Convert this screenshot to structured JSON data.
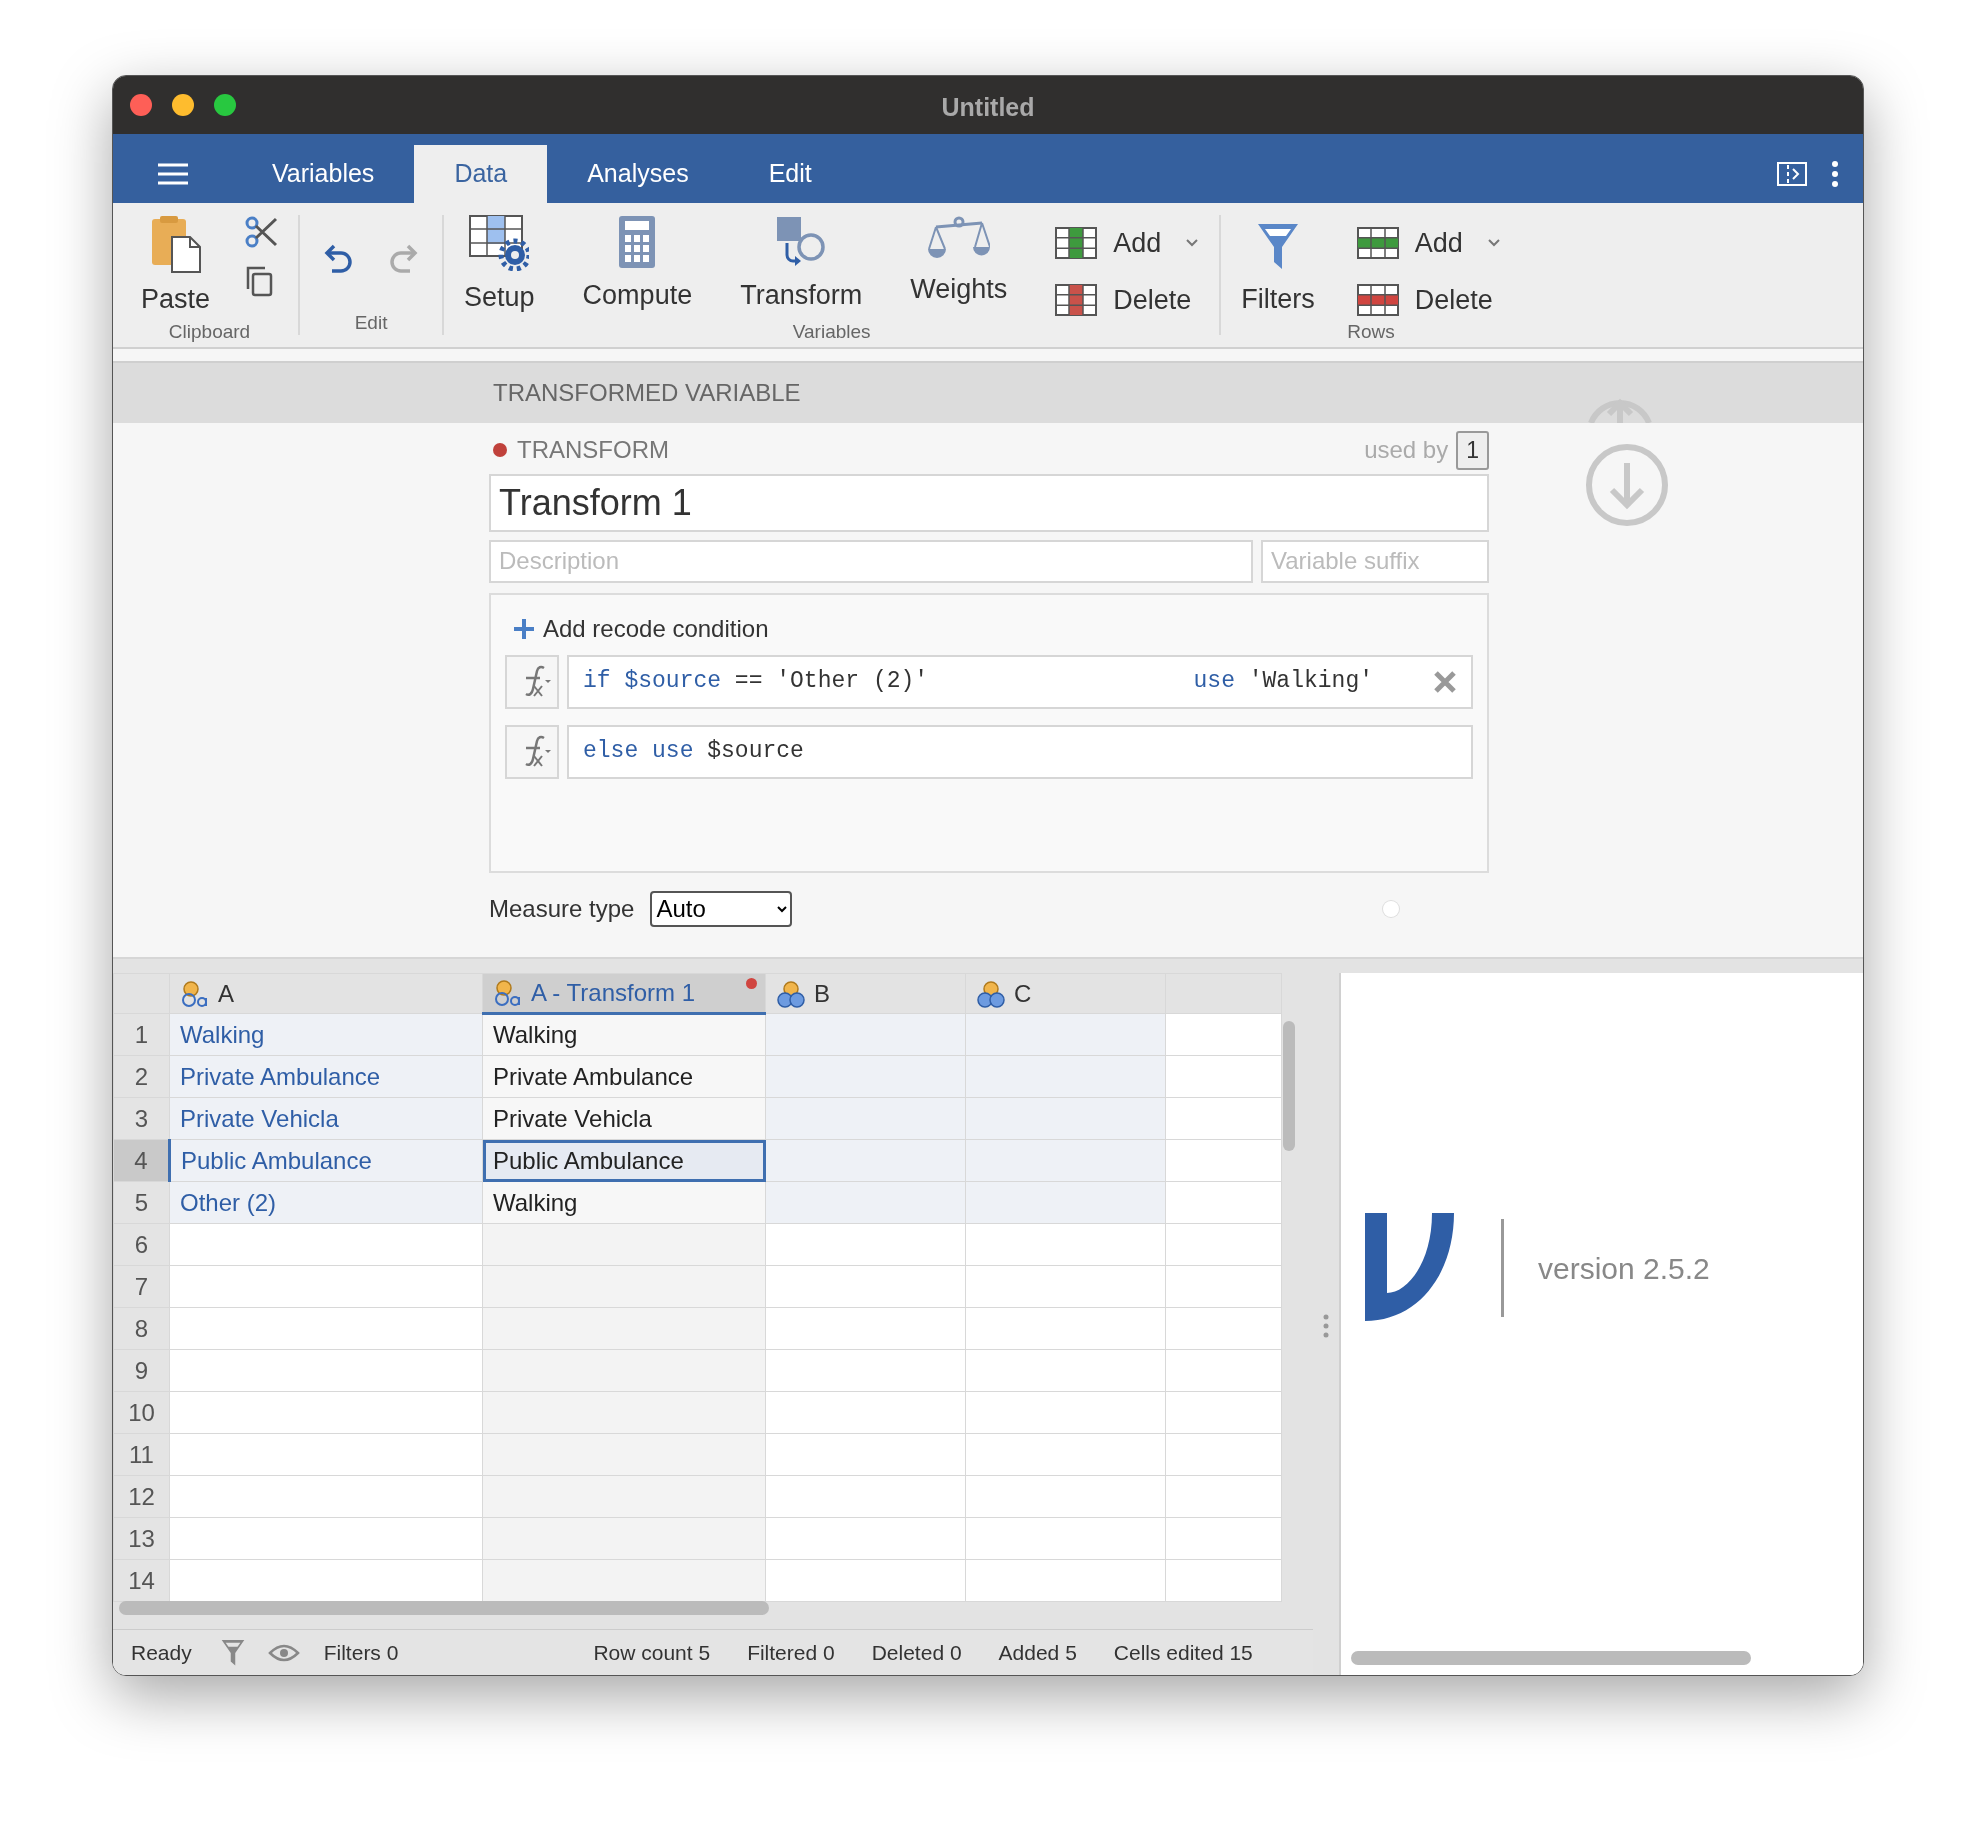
{
  "window": {
    "title": "Untitled"
  },
  "tabs": [
    {
      "label": "Variables",
      "selected": false
    },
    {
      "label": "Data",
      "selected": true
    },
    {
      "label": "Analyses",
      "selected": false
    },
    {
      "label": "Edit",
      "selected": false
    }
  ],
  "ribbon": [
    {
      "label": "Clipboard",
      "items": [
        {
          "kind": "paste",
          "label": "Paste"
        },
        {
          "kind": "clip-tools"
        }
      ]
    },
    {
      "label": "Edit",
      "items": [
        {
          "kind": "undo",
          "disabled": false
        },
        {
          "kind": "redo",
          "disabled": true
        }
      ]
    },
    {
      "label": "Variables",
      "items": [
        {
          "kind": "setup",
          "label": "Setup"
        },
        {
          "kind": "compute",
          "label": "Compute"
        },
        {
          "kind": "transform",
          "label": "Transform"
        },
        {
          "kind": "weights",
          "label": "Weights"
        },
        {
          "kind": "column-stack",
          "buttons": [
            {
              "label": "Add",
              "dropdown": true
            },
            {
              "label": "Delete",
              "dropdown": false
            }
          ]
        }
      ]
    },
    {
      "label": "Rows",
      "items": [
        {
          "kind": "filters",
          "label": "Filters"
        },
        {
          "kind": "row-stack",
          "buttons": [
            {
              "label": "Add",
              "dropdown": true
            },
            {
              "label": "Delete",
              "dropdown": false
            }
          ]
        }
      ]
    }
  ],
  "panel": {
    "header": "TRANSFORMED VARIABLE",
    "section": "TRANSFORM",
    "used_by_label": "used by",
    "used_by": "1",
    "name": "Transform 1",
    "description": {
      "placeholder": "Description"
    },
    "suffix": {
      "placeholder": "Variable suffix"
    },
    "add_condition": "Add recode condition",
    "conditions": [
      {
        "kind": "condition",
        "tokens": [
          {
            "kind": "keyword",
            "text": "if"
          },
          {
            "kind": "variable",
            "text": "$source"
          },
          {
            "kind": "plain",
            "text": "== 'Other (2)'"
          }
        ],
        "use": [
          {
            "kind": "keyword",
            "text": "use"
          },
          {
            "kind": "plain",
            "text": "'Walking'"
          }
        ]
      },
      {
        "kind": "else",
        "tokens": [
          {
            "kind": "keyword",
            "text": "else"
          },
          {
            "kind": "keyword",
            "text": "use"
          },
          {
            "kind": "plain",
            "text": "$source"
          }
        ]
      }
    ],
    "measure_label": "Measure type",
    "measure_value": "Auto"
  },
  "table": {
    "columns": [
      {
        "name": "A",
        "kind": "text-data",
        "selected": false,
        "modified": false
      },
      {
        "name": "A - Transform 1",
        "kind": "text-computed",
        "selected": true,
        "modified": true
      },
      {
        "name": "B",
        "kind": "nominal",
        "selected": false,
        "modified": false
      },
      {
        "name": "C",
        "kind": "nominal",
        "selected": false,
        "modified": false
      }
    ],
    "rows": [
      {
        "number": "1",
        "selected": false,
        "cells": [
          "Walking",
          "Walking"
        ]
      },
      {
        "number": "2",
        "selected": false,
        "cells": [
          "Private Ambulance",
          "Private Ambulance"
        ]
      },
      {
        "number": "3",
        "selected": false,
        "cells": [
          "Private Vehicla",
          "Private Vehicla"
        ]
      },
      {
        "number": "4",
        "selected": true,
        "cells": [
          "Public Ambulance",
          "Public Ambulance"
        ]
      },
      {
        "number": "5",
        "selected": false,
        "cells": [
          "Other (2)",
          "Walking"
        ]
      },
      {
        "number": "6",
        "selected": false
      },
      {
        "number": "7",
        "selected": false
      },
      {
        "number": "8",
        "selected": false
      },
      {
        "number": "9",
        "selected": false
      },
      {
        "number": "10",
        "selected": false
      },
      {
        "number": "11",
        "selected": false
      },
      {
        "number": "12",
        "selected": false
      },
      {
        "number": "13",
        "selected": false
      },
      {
        "number": "14",
        "selected": false
      }
    ]
  },
  "results": {
    "version": "version 2.5.2"
  },
  "status_bar": {
    "state": "Ready",
    "filters": "Filters 0",
    "counts": [
      "Row count 5",
      "Filtered 0",
      "Deleted 0",
      "Added 5",
      "Cells edited 15"
    ]
  }
}
